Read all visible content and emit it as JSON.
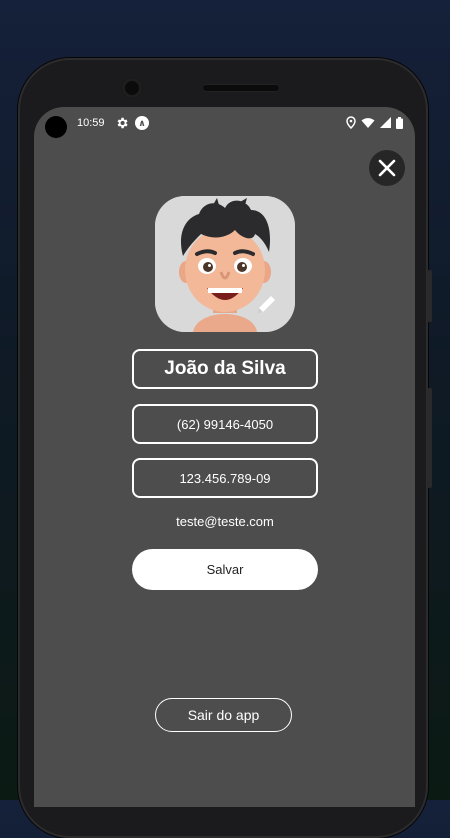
{
  "status_bar": {
    "time": "10:59",
    "icons": [
      "settings-icon",
      "accessibility-a-icon",
      "location-icon",
      "wifi-icon",
      "signal-icon",
      "battery-icon"
    ]
  },
  "profile": {
    "avatar": "memoji-avatar",
    "name": "João da Silva",
    "phone": "(62) 99146-4050",
    "cpf": "123.456.789-09",
    "email": "teste@teste.com"
  },
  "actions": {
    "save_label": "Salvar",
    "logout_label": "Sair do app"
  },
  "colors": {
    "screen_bg": "#4d4d4d",
    "close_bg": "#262626",
    "field_border": "#ffffff",
    "save_bg": "#ffffff"
  }
}
